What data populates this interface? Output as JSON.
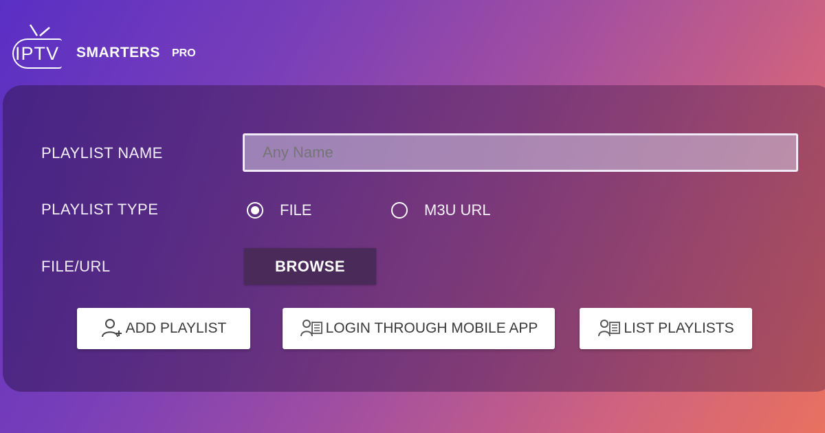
{
  "app": {
    "logo_iptv": "IPTV",
    "logo_smarters": "SMARTERS",
    "logo_pro": "PRO"
  },
  "form": {
    "playlist_name_label": "PLAYLIST NAME",
    "playlist_name_placeholder": "Any Name",
    "playlist_type_label": "PLAYLIST TYPE",
    "type_options": [
      {
        "label": "FILE",
        "selected": true
      },
      {
        "label": "M3U URL",
        "selected": false
      }
    ],
    "file_url_label": "FILE/URL",
    "browse_label": "BROWSE"
  },
  "actions": {
    "add_playlist": {
      "label": "ADD PLAYLIST",
      "icon": "add-user-icon"
    },
    "login_mobile": {
      "label": "LOGIN THROUGH MOBILE APP",
      "icon": "users-list-icon"
    },
    "list_playlists": {
      "label": "LIST PLAYLISTS",
      "icon": "users-list-icon"
    }
  },
  "colors": {
    "gradient_start": "#5a2fc4",
    "gradient_end": "#e8715f",
    "browse_bg": "#4a2a58"
  }
}
